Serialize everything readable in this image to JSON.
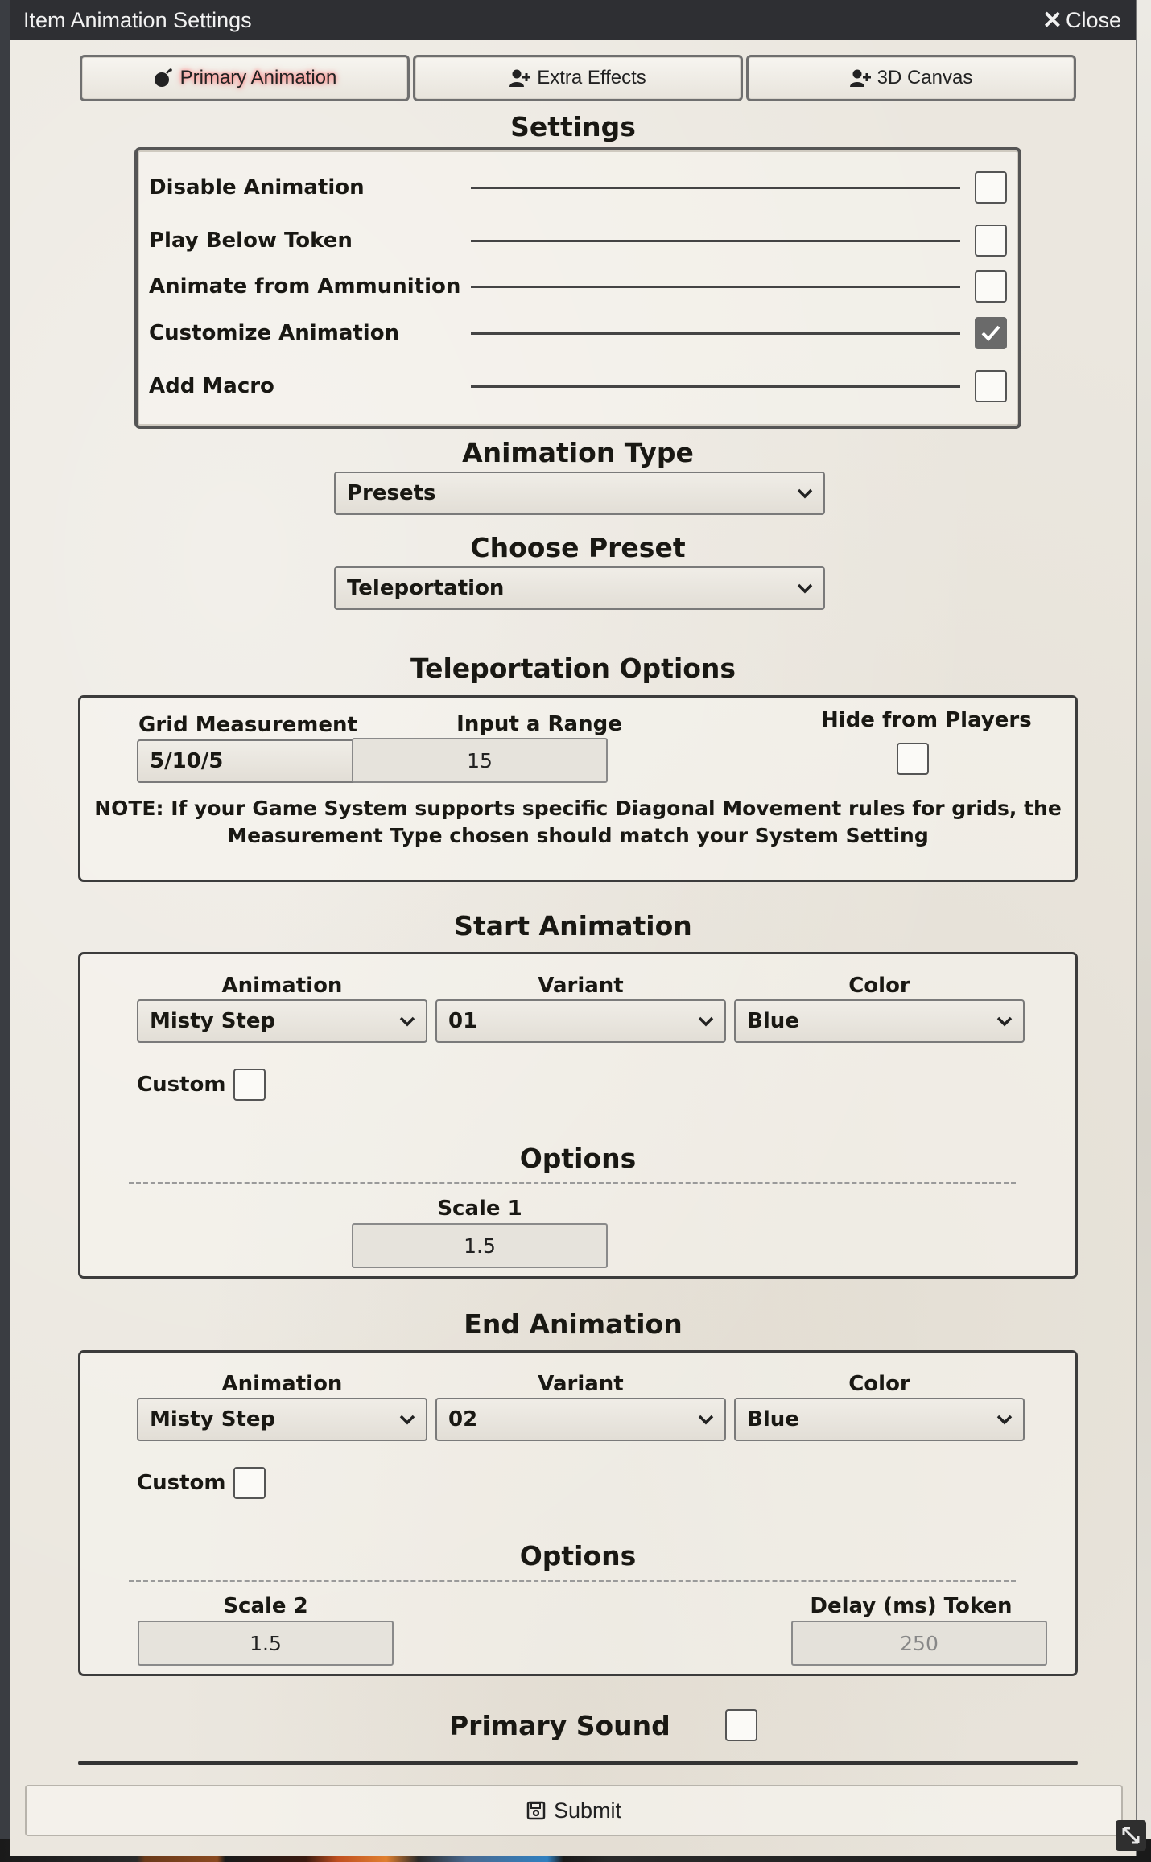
{
  "window": {
    "title": "Item Animation Settings",
    "close_label": "Close"
  },
  "tabs": [
    {
      "label": "Primary Animation",
      "icon": "bomb-icon",
      "active": true
    },
    {
      "label": "Extra Effects",
      "icon": "user-plus-icon",
      "active": false
    },
    {
      "label": "3D Canvas",
      "icon": "user-plus-icon",
      "active": false
    }
  ],
  "settings": {
    "title": "Settings",
    "rows": [
      {
        "label": "Disable Animation",
        "checked": false
      },
      {
        "label": "Play Below Token",
        "checked": false
      },
      {
        "label": "Animate from Ammunition",
        "checked": false
      },
      {
        "label": "Customize Animation",
        "checked": true
      },
      {
        "label": "Add Macro",
        "checked": false
      }
    ]
  },
  "animation_type": {
    "title": "Animation Type",
    "value": "Presets"
  },
  "choose_preset": {
    "title": "Choose Preset",
    "value": "Teleportation"
  },
  "teleportation": {
    "title": "Teleportation Options",
    "grid_label": "Grid Measurement",
    "grid_value": "5/10/5",
    "range_label": "Input a Range",
    "range_value": "15",
    "hide_label": "Hide from Players",
    "hide_checked": false,
    "note_line1": "NOTE: If your Game System supports specific Diagonal Movement rules for grids, the",
    "note_line2": "Measurement Type chosen should match your System Setting"
  },
  "start_animation": {
    "title": "Start Animation",
    "animation_label": "Animation",
    "animation_value": "Misty Step",
    "variant_label": "Variant",
    "variant_value": "01",
    "color_label": "Color",
    "color_value": "Blue",
    "custom_label": "Custom",
    "options_title": "Options",
    "scale_label": "Scale 1",
    "scale_value": "1.5"
  },
  "end_animation": {
    "title": "End Animation",
    "animation_label": "Animation",
    "animation_value": "Misty Step",
    "variant_label": "Variant",
    "variant_value": "02",
    "color_label": "Color",
    "color_value": "Blue",
    "custom_label": "Custom",
    "options_title": "Options",
    "scale_label": "Scale 2",
    "scale_value": "1.5",
    "delay_label": "Delay (ms) Token Alpha",
    "delay_value": "250"
  },
  "primary_sound": {
    "label": "Primary Sound",
    "checked": false
  },
  "submit": {
    "label": "Submit"
  },
  "colors": {
    "titlebar": "#2e2f33",
    "background": "#ebe7df",
    "checked_box": "#6a6a6a"
  }
}
